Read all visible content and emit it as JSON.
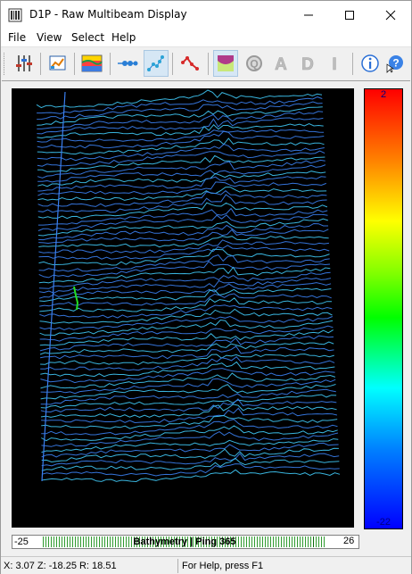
{
  "window": {
    "title": "D1P - Raw Multibeam Display",
    "controls": [
      "minimize",
      "maximize",
      "close"
    ]
  },
  "menu": [
    {
      "label": "File"
    },
    {
      "label": "View"
    },
    {
      "label": "Select"
    },
    {
      "label": "Help"
    }
  ],
  "toolbar": {
    "buttons": [
      {
        "icon": "sliders-icon"
      },
      {
        "icon": "chart-edit-icon"
      },
      {
        "icon": "color-map-icon"
      },
      {
        "icon": "beam-points-icon"
      },
      {
        "icon": "scatter-points-icon"
      },
      {
        "icon": "profile-line-icon"
      },
      {
        "icon": "bathymetry-view-icon"
      },
      {
        "icon": "q-mode-icon",
        "label": "Q"
      },
      {
        "icon": "a-mode-icon",
        "label": "A"
      },
      {
        "icon": "d-mode-icon",
        "label": "D"
      },
      {
        "icon": "i-mode-icon",
        "label": "I"
      },
      {
        "icon": "info-icon"
      },
      {
        "icon": "context-help-icon"
      }
    ]
  },
  "colorbar": {
    "max_label": "2",
    "min_label": "-22"
  },
  "ping_bar": {
    "left_value": "-25",
    "center_text": "Bathymetry | Ping 365",
    "right_value": "26"
  },
  "status": {
    "coords": "X: 3.07  Z: -18.25  R: 18.51",
    "help": "For Help, press F1"
  },
  "colors": {
    "plot_background": "#000000",
    "line_blue": "#3a7ff0",
    "line_cyan": "#3fc8f5",
    "highlight_green": "#22dd22"
  }
}
